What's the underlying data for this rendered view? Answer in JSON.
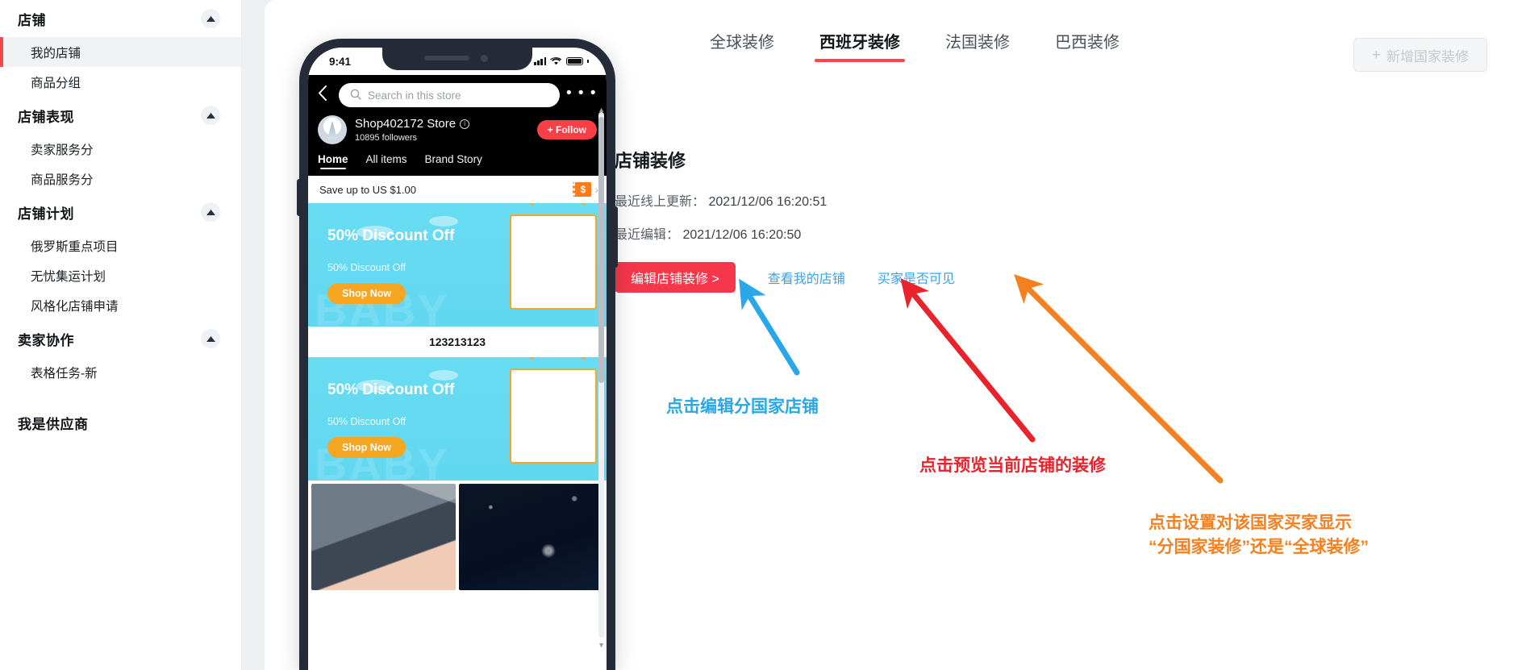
{
  "sidebar": {
    "groups": [
      {
        "title": "店铺",
        "collapsible": true,
        "items": [
          {
            "label": "我的店铺",
            "active": true
          },
          {
            "label": "商品分组",
            "active": false
          }
        ]
      },
      {
        "title": "店铺表现",
        "collapsible": true,
        "items": [
          {
            "label": "卖家服务分",
            "active": false
          },
          {
            "label": "商品服务分",
            "active": false
          }
        ]
      },
      {
        "title": "店铺计划",
        "collapsible": true,
        "items": [
          {
            "label": "俄罗斯重点项目",
            "active": false
          },
          {
            "label": "无忧集运计划",
            "active": false
          },
          {
            "label": "风格化店铺申请",
            "active": false
          }
        ]
      },
      {
        "title": "卖家协作",
        "collapsible": true,
        "items": [
          {
            "label": "表格任务-新",
            "active": false
          }
        ]
      },
      {
        "title": "我是供应商",
        "collapsible": false,
        "items": []
      }
    ]
  },
  "header": {
    "tabs": [
      {
        "label": "全球装修",
        "active": false
      },
      {
        "label": "西班牙装修",
        "active": true
      },
      {
        "label": "法国装修",
        "active": false
      },
      {
        "label": "巴西装修",
        "active": false
      }
    ],
    "add_button": {
      "plus": "+",
      "label": "新增国家装修",
      "disabled": true
    }
  },
  "info": {
    "title": "店铺装修",
    "last_online_label": "最近线上更新：",
    "last_online_value": "2021/12/06 16:20:51",
    "last_edit_label": "最近编辑：",
    "last_edit_value": "2021/12/06 16:20:50",
    "primary_button": "编辑店铺装修 >",
    "link_view_store": "查看我的店铺",
    "link_buyer_visible": "买家是否可见"
  },
  "phone": {
    "status": {
      "time": "9:41"
    },
    "search_placeholder": "Search in this store",
    "more_dots": "• • •",
    "store_name": "Shop402172 Store",
    "followers": "10895  followers",
    "follow_button": "+ Follow",
    "store_tabs": [
      {
        "label": "Home",
        "active": true
      },
      {
        "label": "All items",
        "active": false
      },
      {
        "label": "Brand Story",
        "active": false
      }
    ],
    "coupon_text": "Save up to US $1.00",
    "coupon_chip": "$",
    "banners": [
      {
        "title": "50% Discount Off",
        "subtitle": "50% Discount Off",
        "cta": "Shop Now",
        "ghost": "BABY"
      },
      {
        "title": "50% Discount Off",
        "subtitle": "50% Discount Off",
        "cta": "Shop Now",
        "ghost": "BABY"
      }
    ],
    "divider_text": "123213123"
  },
  "annotations": {
    "blue": "点击编辑分国家店铺",
    "red": "点击预览当前店铺的装修",
    "orange_line1": "点击设置对该国家买家显示",
    "orange_line2": "“分国家装修”还是“全球装修”"
  },
  "colors": {
    "accent_red": "#f5374b",
    "link_blue": "#3aa3e3",
    "anno_blue": "#2aa7e8",
    "anno_red": "#e8232c",
    "anno_orange": "#f58020",
    "active_tab_underline": "#f5484a"
  }
}
